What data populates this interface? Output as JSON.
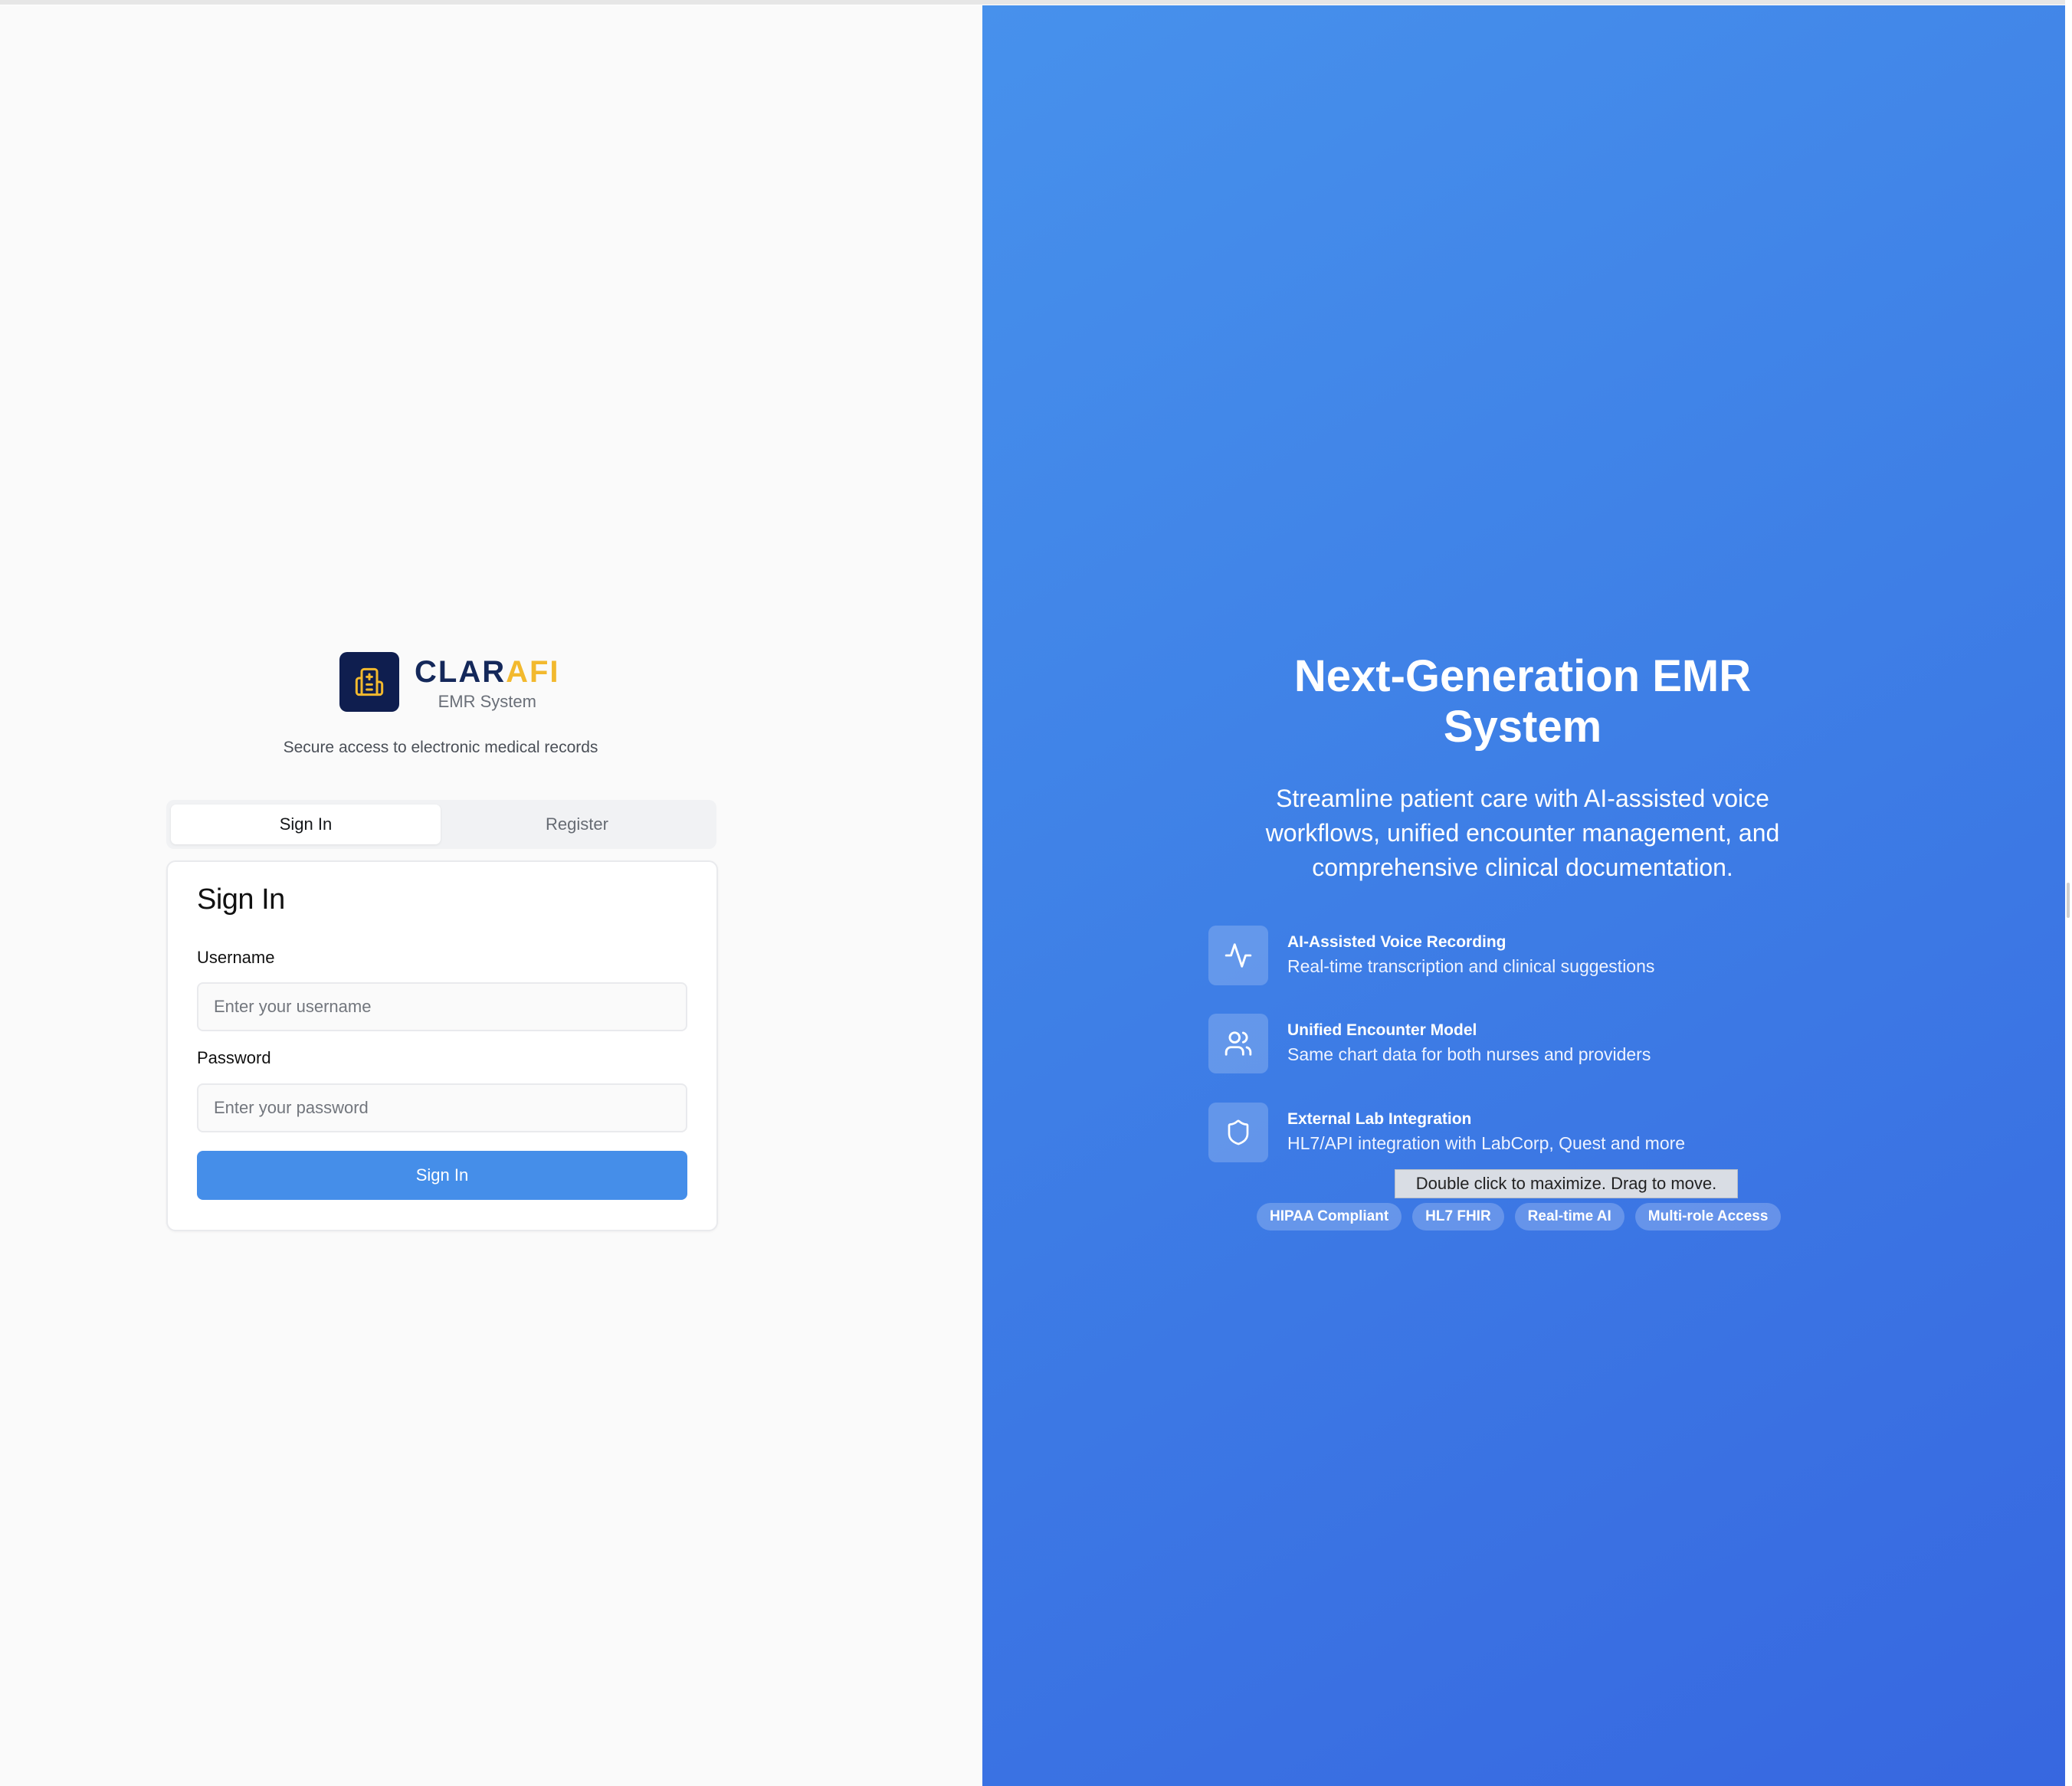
{
  "brand": {
    "name_part1": "CLAR",
    "name_part2": "AFI",
    "subtitle": "EMR System",
    "accent_color": "#f2b92e",
    "primary_color": "#0f1e4f",
    "logo_icon": "hospital-icon"
  },
  "tagline": "Secure access to electronic medical records",
  "tabs": [
    {
      "label": "Sign In",
      "active": true
    },
    {
      "label": "Register",
      "active": false
    }
  ],
  "form": {
    "title": "Sign In",
    "username_label": "Username",
    "username_placeholder": "Enter your username",
    "password_label": "Password",
    "password_placeholder": "Enter your password",
    "submit_label": "Sign In",
    "submit_color": "#458ee9"
  },
  "hero": {
    "title": "Next-Generation EMR System",
    "description": "Streamline patient care with AI-assisted voice workflows, unified encounter management, and comprehensive clinical documentation.",
    "features": [
      {
        "icon": "activity-icon",
        "title": "AI-Assisted Voice Recording",
        "description": "Real-time transcription and clinical suggestions"
      },
      {
        "icon": "users-icon",
        "title": "Unified Encounter Model",
        "description": "Same chart data for both nurses and providers"
      },
      {
        "icon": "shield-icon",
        "title": "External Lab Integration",
        "description": "HL7/API integration with LabCorp, Quest and more"
      }
    ],
    "badges": [
      "HIPAA Compliant",
      "HL7 FHIR",
      "Real-time AI",
      "Multi-role Access"
    ]
  },
  "tooltip": "Double click to maximize. Drag to move."
}
